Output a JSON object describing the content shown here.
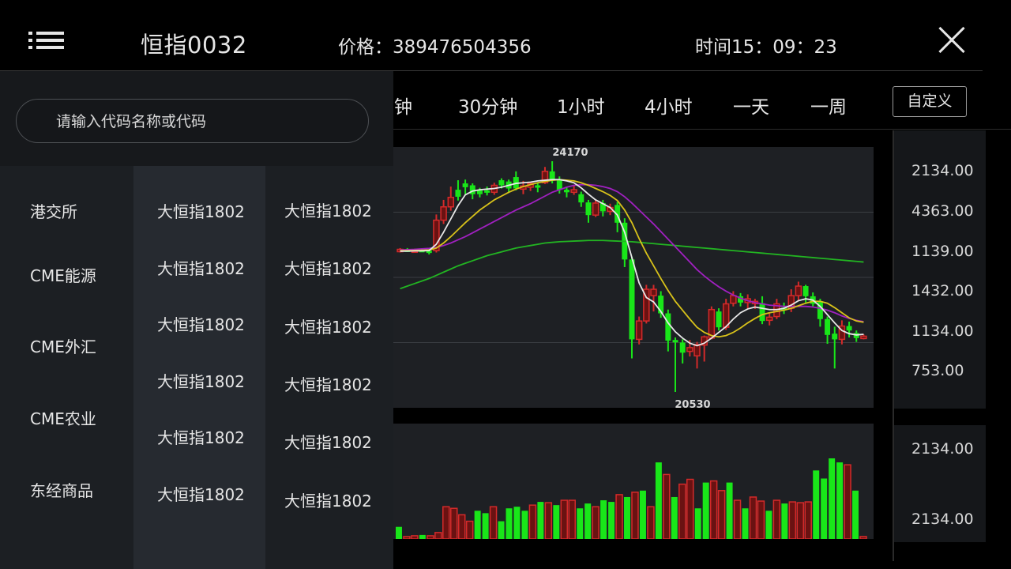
{
  "header": {
    "menu_icon": "hamburger-menu-icon",
    "title": "恒指0032",
    "price": "价格：389476504356",
    "time": "时间15：09：23",
    "close_icon": "close-icon"
  },
  "periods": {
    "items": [
      "分钟",
      "30分钟",
      "1小时",
      "4小时",
      "一天",
      "一周"
    ],
    "custom_label": "自定义"
  },
  "search": {
    "placeholder": "请输入代码名称或代码"
  },
  "drawer": {
    "categories": [
      "港交所",
      "CME能源",
      "CME外汇",
      "CME农业",
      "东经商品"
    ],
    "contracts_col1": [
      "大恒指1802",
      "大恒指1802",
      "大恒指1802",
      "大恒指1802",
      "大恒指1802",
      "大恒指1802"
    ],
    "contracts_col2": [
      "大恒指1802",
      "大恒指1802",
      "大恒指1802",
      "大恒指1802",
      "大恒指1802",
      "大恒指1802"
    ]
  },
  "chart": {
    "high_label": "24170",
    "low_label": "20530",
    "price_axis": [
      "2134.00",
      "4363.00",
      "1139.00",
      "1432.00",
      "1134.00",
      "753.00"
    ],
    "volume_axis": [
      "2134.00",
      "2134.00"
    ],
    "colors": {
      "up": "#19e619",
      "down": "#d42a2a",
      "ma_white": "#e8e8e8",
      "ma_yellow": "#d8c21a",
      "ma_purple": "#a020c0",
      "ma_green": "#22b422",
      "panel_bg": "#1e2024"
    }
  },
  "chart_data": {
    "type": "candlestick",
    "annotations": [
      "24170",
      "20530"
    ],
    "y_axis_ticks": [
      "2134.00",
      "4363.00",
      "1139.00",
      "1432.00",
      "1134.00",
      "753.00"
    ],
    "candles": [
      {
        "o": 22780,
        "c": 22760,
        "h": 22800,
        "l": 22730,
        "dir": "down"
      },
      {
        "o": 22760,
        "c": 22775,
        "h": 22800,
        "l": 22740,
        "dir": "up"
      },
      {
        "o": 22770,
        "c": 22760,
        "h": 22790,
        "l": 22730,
        "dir": "down"
      },
      {
        "o": 22760,
        "c": 22770,
        "h": 22790,
        "l": 22740,
        "dir": "up"
      },
      {
        "o": 22750,
        "c": 22760,
        "h": 22800,
        "l": 22700,
        "dir": "up"
      },
      {
        "o": 22760,
        "c": 23240,
        "h": 23330,
        "l": 22730,
        "dir": "down"
      },
      {
        "o": 23240,
        "c": 23450,
        "h": 23560,
        "l": 23180,
        "dir": "down"
      },
      {
        "o": 23450,
        "c": 23600,
        "h": 23770,
        "l": 23390,
        "dir": "down"
      },
      {
        "o": 23610,
        "c": 23720,
        "h": 23870,
        "l": 23550,
        "dir": "up"
      },
      {
        "o": 23760,
        "c": 23820,
        "h": 23880,
        "l": 23650,
        "dir": "up"
      },
      {
        "o": 23790,
        "c": 23650,
        "h": 23820,
        "l": 23570,
        "dir": "up"
      },
      {
        "o": 23650,
        "c": 23710,
        "h": 23750,
        "l": 23600,
        "dir": "up"
      },
      {
        "o": 23710,
        "c": 23680,
        "h": 23770,
        "l": 23630,
        "dir": "up"
      },
      {
        "o": 23680,
        "c": 23790,
        "h": 23830,
        "l": 23640,
        "dir": "down"
      },
      {
        "o": 23790,
        "c": 23870,
        "h": 23900,
        "l": 23740,
        "dir": "up"
      },
      {
        "o": 23850,
        "c": 23740,
        "h": 23880,
        "l": 23670,
        "dir": "up"
      },
      {
        "o": 23740,
        "c": 23920,
        "h": 24010,
        "l": 23710,
        "dir": "up"
      },
      {
        "o": 23780,
        "c": 23730,
        "h": 23860,
        "l": 23650,
        "dir": "down"
      },
      {
        "o": 23760,
        "c": 23820,
        "h": 23840,
        "l": 23700,
        "dir": "down"
      },
      {
        "o": 23790,
        "c": 23770,
        "h": 23830,
        "l": 23680,
        "dir": "up"
      },
      {
        "o": 23830,
        "c": 24010,
        "h": 24080,
        "l": 23810,
        "dir": "down"
      },
      {
        "o": 24010,
        "c": 23880,
        "h": 24170,
        "l": 23820,
        "dir": "up"
      },
      {
        "o": 23880,
        "c": 23720,
        "h": 23930,
        "l": 23660,
        "dir": "up"
      },
      {
        "o": 23720,
        "c": 23680,
        "h": 23770,
        "l": 23600,
        "dir": "up"
      },
      {
        "o": 23680,
        "c": 23720,
        "h": 23790,
        "l": 23640,
        "dir": "down"
      },
      {
        "o": 23650,
        "c": 23520,
        "h": 23690,
        "l": 23450,
        "dir": "up"
      },
      {
        "o": 23520,
        "c": 23320,
        "h": 23560,
        "l": 23200,
        "dir": "up"
      },
      {
        "o": 23320,
        "c": 23510,
        "h": 23560,
        "l": 23290,
        "dir": "down"
      },
      {
        "o": 23510,
        "c": 23380,
        "h": 23560,
        "l": 23300,
        "dir": "up"
      },
      {
        "o": 23380,
        "c": 23440,
        "h": 23500,
        "l": 23320,
        "dir": "down"
      },
      {
        "o": 23480,
        "c": 23200,
        "h": 23530,
        "l": 23050,
        "dir": "up"
      },
      {
        "o": 23200,
        "c": 22620,
        "h": 23270,
        "l": 22500,
        "dir": "up"
      },
      {
        "o": 22620,
        "c": 21360,
        "h": 22660,
        "l": 21060,
        "dir": "up"
      },
      {
        "o": 21360,
        "c": 21650,
        "h": 21720,
        "l": 21280,
        "dir": "down"
      },
      {
        "o": 21650,
        "c": 22150,
        "h": 22220,
        "l": 21610,
        "dir": "down"
      },
      {
        "o": 22150,
        "c": 22050,
        "h": 22220,
        "l": 21800,
        "dir": "down"
      },
      {
        "o": 22050,
        "c": 21770,
        "h": 22120,
        "l": 21700,
        "dir": "up"
      },
      {
        "o": 21770,
        "c": 21340,
        "h": 21830,
        "l": 21170,
        "dir": "up"
      },
      {
        "o": 21340,
        "c": 21350,
        "h": 21390,
        "l": 20530,
        "dir": "up"
      },
      {
        "o": 21310,
        "c": 21150,
        "h": 21360,
        "l": 20980,
        "dir": "up"
      },
      {
        "o": 21170,
        "c": 21230,
        "h": 21350,
        "l": 21090,
        "dir": "down"
      },
      {
        "o": 21100,
        "c": 21280,
        "h": 21320,
        "l": 20900,
        "dir": "down"
      },
      {
        "o": 21270,
        "c": 21400,
        "h": 21420,
        "l": 21010,
        "dir": "down"
      },
      {
        "o": 21380,
        "c": 21830,
        "h": 21880,
        "l": 21360,
        "dir": "down"
      },
      {
        "o": 21800,
        "c": 21550,
        "h": 21850,
        "l": 21500,
        "dir": "up"
      },
      {
        "o": 21550,
        "c": 21920,
        "h": 22000,
        "l": 21510,
        "dir": "down"
      },
      {
        "o": 21930,
        "c": 22050,
        "h": 22120,
        "l": 21880,
        "dir": "down"
      },
      {
        "o": 22040,
        "c": 21940,
        "h": 22090,
        "l": 21880,
        "dir": "up"
      },
      {
        "o": 21940,
        "c": 22000,
        "h": 22070,
        "l": 21850,
        "dir": "down"
      },
      {
        "o": 21960,
        "c": 21950,
        "h": 22000,
        "l": 21840,
        "dir": "down"
      },
      {
        "o": 21930,
        "c": 21650,
        "h": 22040,
        "l": 21600,
        "dir": "up"
      },
      {
        "o": 21660,
        "c": 21710,
        "h": 21770,
        "l": 21580,
        "dir": "down"
      },
      {
        "o": 21720,
        "c": 21920,
        "h": 22000,
        "l": 21680,
        "dir": "down"
      },
      {
        "o": 21860,
        "c": 21850,
        "h": 21940,
        "l": 21760,
        "dir": "up"
      },
      {
        "o": 21850,
        "c": 22050,
        "h": 22150,
        "l": 21790,
        "dir": "down"
      },
      {
        "o": 22050,
        "c": 22200,
        "h": 22270,
        "l": 21970,
        "dir": "down"
      },
      {
        "o": 22200,
        "c": 22040,
        "h": 22220,
        "l": 21940,
        "dir": "up"
      },
      {
        "o": 22040,
        "c": 21920,
        "h": 22100,
        "l": 21880,
        "dir": "up"
      },
      {
        "o": 21960,
        "c": 21680,
        "h": 22000,
        "l": 21560,
        "dir": "up"
      },
      {
        "o": 21680,
        "c": 21430,
        "h": 21720,
        "l": 21290,
        "dir": "up"
      },
      {
        "o": 21450,
        "c": 21360,
        "h": 21560,
        "l": 20900,
        "dir": "up"
      },
      {
        "o": 21360,
        "c": 21570,
        "h": 21660,
        "l": 21280,
        "dir": "down"
      },
      {
        "o": 21570,
        "c": 21500,
        "h": 21640,
        "l": 21390,
        "dir": "up"
      },
      {
        "o": 21460,
        "c": 21380,
        "h": 21500,
        "l": 21320,
        "dir": "up"
      },
      {
        "o": 21390,
        "c": 21410,
        "h": 21440,
        "l": 21360,
        "dir": "down"
      }
    ],
    "ma_white": [
      22750,
      22752,
      22755,
      22757,
      22760,
      22860,
      23050,
      23260,
      23470,
      23640,
      23700,
      23720,
      23730,
      23740,
      23760,
      23790,
      23820,
      23830,
      23840,
      23860,
      23870,
      23880,
      23880,
      23860,
      23830,
      23750,
      23650,
      23560,
      23500,
      23440,
      23320,
      23050,
      22650,
      22250,
      22020,
      21950,
      21800,
      21620,
      21480,
      21380,
      21300,
      21260,
      21300,
      21380,
      21470,
      21560,
      21680,
      21780,
      21840,
      21870,
      21850,
      21830,
      21830,
      21850,
      21900,
      21970,
      22000,
      21980,
      21880,
      21750,
      21620,
      21500,
      21450,
      21430,
      21440
    ],
    "ma_yellow": [
      22760,
      22760,
      22762,
      22765,
      22770,
      22800,
      22880,
      22980,
      23090,
      23200,
      23300,
      23400,
      23480,
      23560,
      23620,
      23680,
      23730,
      23770,
      23800,
      23830,
      23850,
      23870,
      23880,
      23870,
      23860,
      23830,
      23790,
      23740,
      23690,
      23630,
      23550,
      23400,
      23200,
      22950,
      22720,
      22520,
      22320,
      22130,
      21960,
      21820,
      21680,
      21550,
      21470,
      21420,
      21400,
      21420,
      21470,
      21540,
      21620,
      21690,
      21750,
      21780,
      21800,
      21820,
      21850,
      21890,
      21930,
      21960,
      21960,
      21930,
      21860,
      21780,
      21700,
      21650,
      21630
    ],
    "ma_purple": [
      22770,
      22775,
      22780,
      22788,
      22795,
      22810,
      22840,
      22880,
      22930,
      22980,
      23040,
      23100,
      23160,
      23220,
      23280,
      23340,
      23400,
      23450,
      23500,
      23560,
      23620,
      23680,
      23720,
      23760,
      23790,
      23800,
      23800,
      23790,
      23770,
      23740,
      23690,
      23610,
      23510,
      23400,
      23290,
      23180,
      23060,
      22940,
      22820,
      22700,
      22580,
      22460,
      22360,
      22270,
      22190,
      22120,
      22060,
      22010,
      21970,
      21940,
      21920,
      21900,
      21890,
      21880,
      21880,
      21880,
      21880,
      21870,
      21850,
      21820,
      21780,
      21730,
      21690,
      21660,
      21640
    ],
    "ma_green": [
      22160,
      22200,
      22240,
      22280,
      22320,
      22370,
      22420,
      22470,
      22520,
      22560,
      22600,
      22640,
      22680,
      22710,
      22740,
      22770,
      22800,
      22820,
      22840,
      22860,
      22880,
      22890,
      22900,
      22905,
      22910,
      22915,
      22920,
      22920,
      22920,
      22915,
      22910,
      22905,
      22900,
      22890,
      22880,
      22870,
      22860,
      22850,
      22840,
      22830,
      22820,
      22810,
      22800,
      22790,
      22780,
      22770,
      22760,
      22750,
      22740,
      22730,
      22720,
      22710,
      22700,
      22690,
      22680,
      22670,
      22660,
      22650,
      22640,
      22630,
      22620,
      22610,
      22600,
      22590,
      22580
    ],
    "volume": [
      15,
      3,
      4,
      5,
      4,
      8,
      40,
      38,
      30,
      22,
      35,
      32,
      40,
      22,
      38,
      40,
      35,
      42,
      46,
      45,
      42,
      48,
      48,
      38,
      44,
      40,
      48,
      46,
      55,
      52,
      58,
      60,
      40,
      95,
      80,
      52,
      68,
      74,
      38,
      70,
      72,
      60,
      70,
      48,
      38,
      52,
      47,
      35,
      48,
      44,
      46,
      45,
      46,
      85,
      75,
      100,
      95,
      92,
      60,
      3
    ],
    "volume_dir": [
      "up",
      "down",
      "down",
      "up",
      "down",
      "down",
      "down",
      "down",
      "down",
      "down",
      "up",
      "up",
      "down",
      "up",
      "up",
      "up",
      "up",
      "down",
      "up",
      "down",
      "up",
      "down",
      "down",
      "up",
      "up",
      "down",
      "up",
      "up",
      "down",
      "up",
      "down",
      "up",
      "down",
      "up",
      "down",
      "up",
      "down",
      "down",
      "up",
      "up",
      "down",
      "down",
      "up",
      "down",
      "up",
      "down",
      "down",
      "up",
      "down",
      "up",
      "down",
      "down",
      "down",
      "up",
      "up",
      "up",
      "up",
      "down",
      "up",
      "down"
    ]
  }
}
